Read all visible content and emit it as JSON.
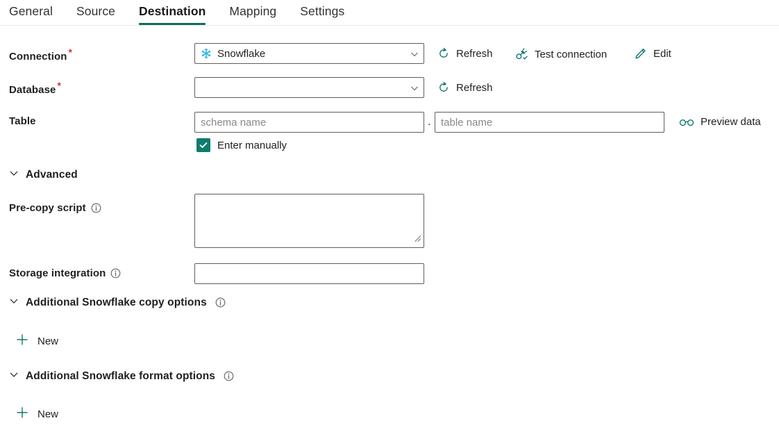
{
  "tabs": [
    {
      "label": "General",
      "active": false
    },
    {
      "label": "Source",
      "active": false
    },
    {
      "label": "Destination",
      "active": true
    },
    {
      "label": "Mapping",
      "active": false
    },
    {
      "label": "Settings",
      "active": false
    }
  ],
  "colors": {
    "accent_teal": "#0f6c63",
    "icon_teal": "#11786f",
    "checkbox_green": "#107c6b",
    "snowflake_blue": "#29b5e8",
    "required_red": "#d13438",
    "field_border": "#605e5c",
    "placeholder": "#8a8886",
    "text": "#201f1e"
  },
  "form": {
    "connection": {
      "label": "Connection",
      "required": true,
      "value": "Snowflake",
      "icon": "snowflake-icon",
      "chevron": "chevron-down-icon",
      "actions": [
        {
          "label": "Refresh",
          "icon": "refresh-icon"
        },
        {
          "label": "Test connection",
          "icon": "plug-check-icon"
        },
        {
          "label": "Edit",
          "icon": "pencil-icon"
        }
      ]
    },
    "database": {
      "label": "Database",
      "required": true,
      "value": "",
      "chevron": "chevron-down-icon",
      "actions": [
        {
          "label": "Refresh",
          "icon": "refresh-icon"
        }
      ]
    },
    "table": {
      "label": "Table",
      "required": false,
      "schema_placeholder": "schema name",
      "schema_value": "",
      "separator": ".",
      "table_placeholder": "table name",
      "table_value": "",
      "preview": {
        "label": "Preview data",
        "icon": "glasses-icon"
      }
    },
    "enter_manually": {
      "label": "Enter manually",
      "checked": true,
      "icon": "checkmark-icon"
    },
    "advanced": {
      "label": "Advanced",
      "expanded": true,
      "chevron": "chevron-down-icon"
    },
    "pre_copy_script": {
      "label": "Pre-copy script",
      "info": "info-icon",
      "value": "",
      "placeholder": ""
    },
    "storage_integration": {
      "label": "Storage integration",
      "info": "info-icon",
      "value": "",
      "placeholder": ""
    },
    "copy_options": {
      "label": "Additional Snowflake copy options",
      "info": "info-icon",
      "expanded": true,
      "chevron": "chevron-down-icon",
      "new_button": {
        "label": "New",
        "icon": "plus-icon"
      }
    },
    "format_options": {
      "label": "Additional Snowflake format options",
      "info": "info-icon",
      "expanded": true,
      "chevron": "chevron-down-icon",
      "new_button": {
        "label": "New",
        "icon": "plus-icon"
      }
    }
  }
}
